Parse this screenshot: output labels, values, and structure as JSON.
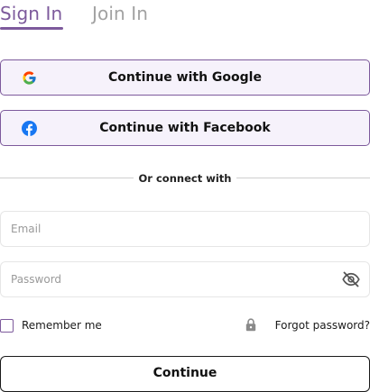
{
  "tabs": {
    "sign_in": "Sign In",
    "join_in": "Join In",
    "active": "Sign In"
  },
  "social": {
    "google": {
      "label": "Continue with Google",
      "icon": "google-icon"
    },
    "facebook": {
      "label": "Continue with Facebook",
      "icon": "facebook-icon"
    }
  },
  "divider": {
    "text": "Or connect with"
  },
  "form": {
    "email": {
      "placeholder": "Email",
      "value": ""
    },
    "password": {
      "placeholder": "Password",
      "value": "",
      "toggle_icon": "eye-off-icon"
    },
    "remember_me": {
      "label": "Remember me",
      "checked": false
    },
    "forgot_password": {
      "label": "Forgot password?",
      "icon": "lock-icon"
    },
    "continue": {
      "label": "Continue"
    }
  },
  "colors": {
    "accent": "#7d5a9c",
    "inactive_tab": "#a2a2a2",
    "social_bg": "#f6f2fb",
    "field_border": "#e6e6e6",
    "placeholder": "#9a9a9a",
    "facebook_blue": "#1877f2"
  }
}
